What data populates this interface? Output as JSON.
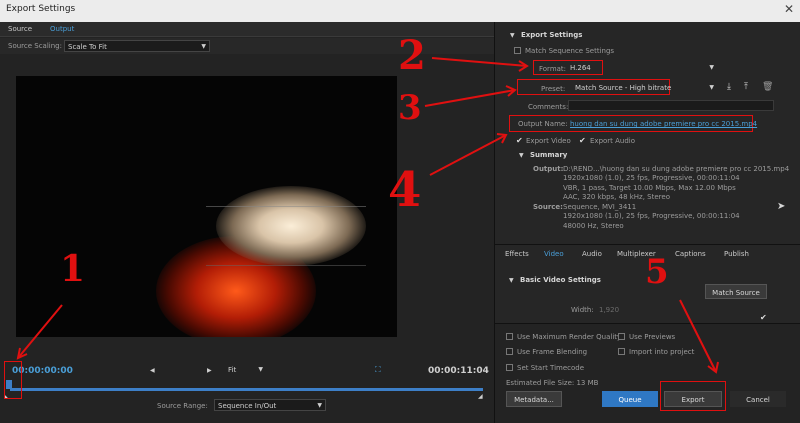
{
  "window": {
    "title": "Export Settings",
    "close": "✕"
  },
  "left": {
    "tabs": [
      "Source",
      "Output"
    ],
    "scaling_label": "Source Scaling:",
    "scaling_value": "Scale To Fit",
    "timecode_start": "00:00:00:00",
    "timecode_end": "00:00:11:04",
    "fit_value": "Fit",
    "source_range_label": "Source Range:",
    "source_range_value": "Sequence In/Out"
  },
  "export_settings": {
    "header": "Export Settings",
    "match_sequence": "Match Sequence Settings",
    "format_label": "Format:",
    "format_value": "H.264",
    "preset_label": "Preset:",
    "preset_value": "Match Source - High bitrate",
    "comments_label": "Comments:",
    "output_name_label": "Output Name:",
    "output_name_value": "huong dan su dung adobe premiere pro cc 2015.mp4",
    "export_video": "Export Video",
    "export_audio": "Export Audio"
  },
  "summary": {
    "header": "Summary",
    "output_label": "Output:",
    "output_lines": [
      "D:\\REND...\\huong dan su dung adobe premiere pro cc 2015.mp4",
      "1920x1080 (1.0), 25 fps, Progressive, 00:00:11:04",
      "VBR, 1 pass, Target 10.00 Mbps, Max 12.00 Mbps",
      "AAC, 320 kbps, 48 kHz, Stereo"
    ],
    "source_label": "Source:",
    "source_lines": [
      "Sequence, MVI_3411",
      "1920x1080 (1.0), 25 fps, Progressive, 00:00:11:04",
      "48000 Hz, Stereo"
    ]
  },
  "subtabs": [
    "Effects",
    "Video",
    "Audio",
    "Multiplexer",
    "Captions",
    "Publish"
  ],
  "video": {
    "header": "Basic Video Settings",
    "match_source": "Match Source",
    "width_label": "Width:",
    "width_value": "1,920"
  },
  "options": {
    "max_render": "Use Maximum Render Quality",
    "use_previews": "Use Previews",
    "frame_blending": "Use Frame Blending",
    "import_project": "Import into project",
    "start_timecode": "Set Start Timecode",
    "file_size": "Estimated File Size: 13 MB"
  },
  "buttons": {
    "metadata": "Metadata...",
    "queue": "Queue",
    "export": "Export",
    "cancel": "Cancel"
  },
  "annotations": [
    "1",
    "2",
    "3",
    "4",
    "5"
  ]
}
